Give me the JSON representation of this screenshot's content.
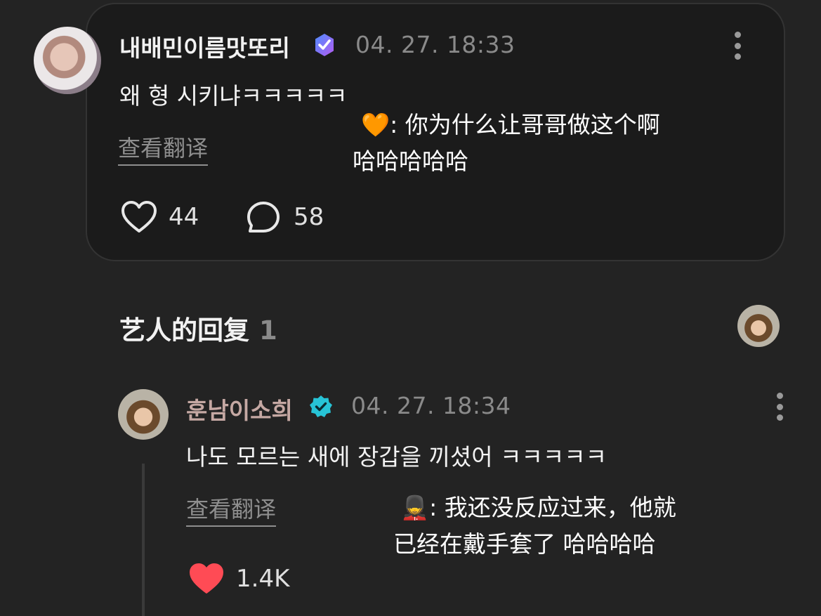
{
  "post": {
    "username": "내배민이름맛또리",
    "timestamp": "04. 27. 18:33",
    "text": "왜 형 시키냐ㅋㅋㅋㅋㅋ",
    "translate_label": "查看翻译",
    "translation_emoji": "🧡",
    "translation": ": 你为什么让哥哥做这个啊 哈哈哈哈哈",
    "likes": "44",
    "comments": "58"
  },
  "replies_section": {
    "title": "艺人的回复",
    "count": "1"
  },
  "reply": {
    "username": "훈남이소희",
    "timestamp": "04. 27. 18:34",
    "text": "나도 모르는 새에 장갑을 끼셨어 ㅋㅋㅋㅋㅋ",
    "translate_label": "查看翻译",
    "translation_emoji": "💂",
    "translation": ": 我还没反应过来，他就已经在戴手套了 哈哈哈哈",
    "likes": "1.4K"
  },
  "colors": {
    "background": "#232323",
    "card": "#1b1b1b",
    "fan_badge": "#8a6cf0",
    "artist_badge": "#27c3d6",
    "artist_name": "#c5a8a3",
    "like_active": "#ff4b55"
  },
  "icons": {
    "verified_fan": "verified-badge-icon",
    "verified_artist": "artist-badge-icon",
    "like": "heart-icon",
    "comment": "comment-bubble-icon",
    "more": "more-vertical-icon"
  }
}
